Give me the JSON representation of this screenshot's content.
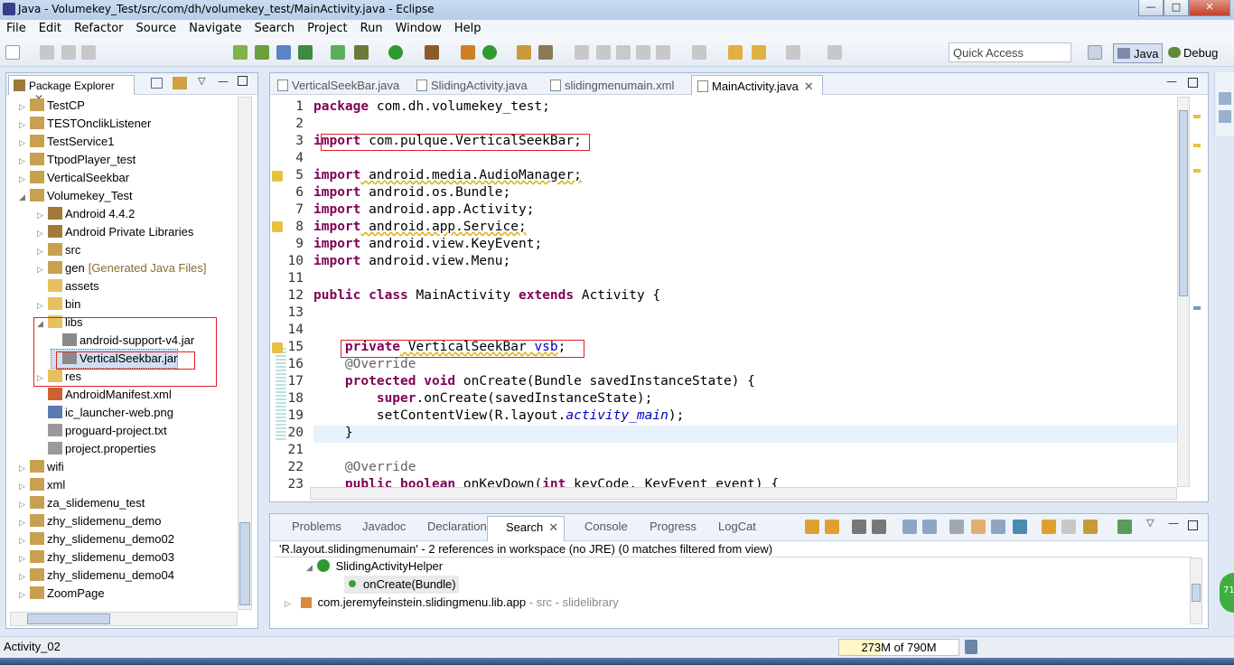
{
  "window": {
    "title": "Java - Volumekey_Test/src/com/dh/volumekey_test/MainActivity.java - Eclipse"
  },
  "menu": [
    "File",
    "Edit",
    "Refactor",
    "Source",
    "Navigate",
    "Search",
    "Project",
    "Run",
    "Window",
    "Help"
  ],
  "quick_access": {
    "placeholder": "Quick Access"
  },
  "perspectives": {
    "java": "Java",
    "debug": "Debug"
  },
  "package_explorer": {
    "title": "Package Explorer",
    "items": [
      {
        "label": "TestCP"
      },
      {
        "label": "TESTOnclikListener"
      },
      {
        "label": "TestService1"
      },
      {
        "label": "TtpodPlayer_test"
      },
      {
        "label": "VerticalSeekbar"
      },
      {
        "label": "Volumekey_Test"
      },
      {
        "label": "Android 4.4.2"
      },
      {
        "label": "Android Private Libraries"
      },
      {
        "label": "src"
      },
      {
        "label": "gen",
        "decoration": "[Generated Java Files]"
      },
      {
        "label": "assets"
      },
      {
        "label": "bin"
      },
      {
        "label": "libs"
      },
      {
        "label": "android-support-v4.jar"
      },
      {
        "label": "VerticalSeekbar.jar"
      },
      {
        "label": "res"
      },
      {
        "label": "AndroidManifest.xml"
      },
      {
        "label": "ic_launcher-web.png"
      },
      {
        "label": "proguard-project.txt"
      },
      {
        "label": "project.properties"
      },
      {
        "label": "wifi"
      },
      {
        "label": "xml"
      },
      {
        "label": "za_slidemenu_test"
      },
      {
        "label": "zhy_slidemenu_demo"
      },
      {
        "label": "zhy_slidemenu_demo02"
      },
      {
        "label": "zhy_slidemenu_demo03"
      },
      {
        "label": "zhy_slidemenu_demo04"
      },
      {
        "label": "ZoomPage"
      }
    ]
  },
  "editor": {
    "tabs": [
      "VerticalSeekBar.java",
      "SlidingActivity.java",
      "slidingmenumain.xml",
      "MainActivity.java"
    ],
    "line_numbers": [
      "1",
      "2",
      "3",
      "4",
      "5",
      "6",
      "7",
      "8",
      "9",
      "10",
      "11",
      "12",
      "13",
      "14",
      "15",
      "16",
      "17",
      "18",
      "19",
      "20",
      "21",
      "22",
      "23"
    ],
    "code": {
      "l1_kw": "package",
      "l1_rest": " com.dh.volumekey_test;",
      "l3_kw": "import",
      "l3_rest": " com.pulque.VerticalSeekBar;",
      "l5_kw": "import",
      "l5_rest": " android.media.AudioManager;",
      "l6_kw": "import",
      "l6_rest": " android.os.Bundle;",
      "l7_kw": "import",
      "l7_rest": " android.app.Activity;",
      "l8_kw": "import",
      "l8_rest": " android.app.Service;",
      "l9_kw": "import",
      "l9_rest": " android.view.KeyEvent;",
      "l10_kw": "import",
      "l10_rest": " android.view.Menu;",
      "l12_kw1": "public",
      "l12_kw2": "class",
      "l12_name": " MainActivity ",
      "l12_kw3": "extends",
      "l12_rest": " Activity {",
      "l15_kw": "private",
      "l15_type": " VerticalSeekBar ",
      "l15_field": "vsb",
      "l15_end": ";",
      "l16": "@Override",
      "l17_kw1": "protected",
      "l17_kw2": "void",
      "l17_rest": " onCreate(Bundle savedInstanceState) {",
      "l18_kw": "super",
      "l18_rest": ".onCreate(savedInstanceState);",
      "l19_a": "setContentView(R.layout.",
      "l19_it": "activity_main",
      "l19_b": ");",
      "l20": "}",
      "l22": "@Override",
      "l23_kw1": "public",
      "l23_kw2": "boolean",
      "l23_a": " onKeyDown(",
      "l23_kw3": "int",
      "l23_b": " keyCode, KeyEvent event) {"
    }
  },
  "bottom_panel": {
    "tabs": [
      "Problems",
      "Javadoc",
      "Declaration",
      "Search",
      "Console",
      "Progress",
      "LogCat"
    ],
    "summary": "'R.layout.slidingmenumain' - 2 references in workspace (no JRE) (0 matches filtered from view)",
    "results": [
      {
        "label": "SlidingActivityHelper"
      },
      {
        "label": "onCreate(Bundle)"
      },
      {
        "label": "com.jeremyfeinstein.slidingmenu.lib.app",
        "decoration": "- src - slidelibrary"
      }
    ]
  },
  "status": {
    "left": "Activity_02",
    "heap": "273M of 790M",
    "heap_fraction": 0.3456
  },
  "colors": {
    "keyword": "#7f0055",
    "annotation": "#646464",
    "field": "#0000c0",
    "highlight_box": "#e02020"
  }
}
